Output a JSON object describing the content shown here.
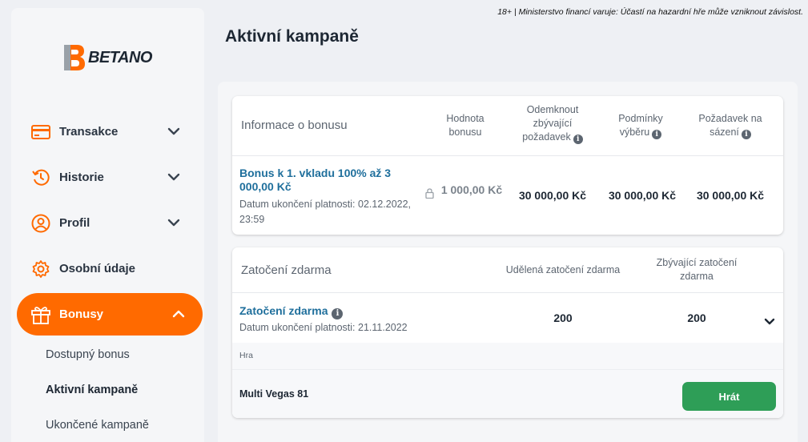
{
  "disclaimer": "18+ | Ministerstvo financí varuje: Účastí na hazardní hře může vzniknout závislost.",
  "brand": {
    "name": "BETANO",
    "accent": "#ff6a00"
  },
  "sidebar": {
    "items": [
      {
        "label": "Transakce",
        "icon": "card-icon"
      },
      {
        "label": "Historie",
        "icon": "history-icon"
      },
      {
        "label": "Profil",
        "icon": "user-icon"
      },
      {
        "label": "Osobní údaje",
        "icon": "gear-icon"
      },
      {
        "label": "Bonusy",
        "icon": "gift-icon",
        "active": true
      }
    ],
    "bonus_subitems": [
      {
        "label": "Dostupný bonus"
      },
      {
        "label": "Aktivní kampaně",
        "current": true
      },
      {
        "label": "Ukončené kampaně"
      }
    ]
  },
  "page": {
    "title": "Aktivní kampaně"
  },
  "bonus_table": {
    "headers": {
      "info": "Informace o bonusu",
      "value": "Hodnota bonusu",
      "unlock": "Odemknout zbývající požadavek",
      "withdraw": "Podmínky výběru",
      "wager": "Požadavek na sázení"
    },
    "row": {
      "name": "Bonus k 1. vkladu 100% až 3 000,00 Kč",
      "expiry": "Datum ukončení platnosti: 02.12.2022, 23:59",
      "value": "1 000,00 Kč",
      "unlock": "30 000,00 Kč",
      "withdraw": "30 000,00 Kč",
      "wager": "30 000,00 Kč"
    }
  },
  "free_spins_table": {
    "headers": {
      "title": "Zatočení zdarma",
      "granted": "Udělená zatočení zdarma",
      "remaining": "Zbývající zatočení zdarma"
    },
    "row": {
      "name": "Zatočení zdarma",
      "expiry": "Datum ukončení platnosti: 21.11.2022",
      "granted": "200",
      "remaining": "200"
    },
    "game_label": "Hra",
    "game_name": "Multi Vegas 81",
    "play_label": "Hrát"
  },
  "colors": {
    "link": "#1f6f9c",
    "play": "#2e9e57",
    "active_nav": "#ff6a00"
  }
}
